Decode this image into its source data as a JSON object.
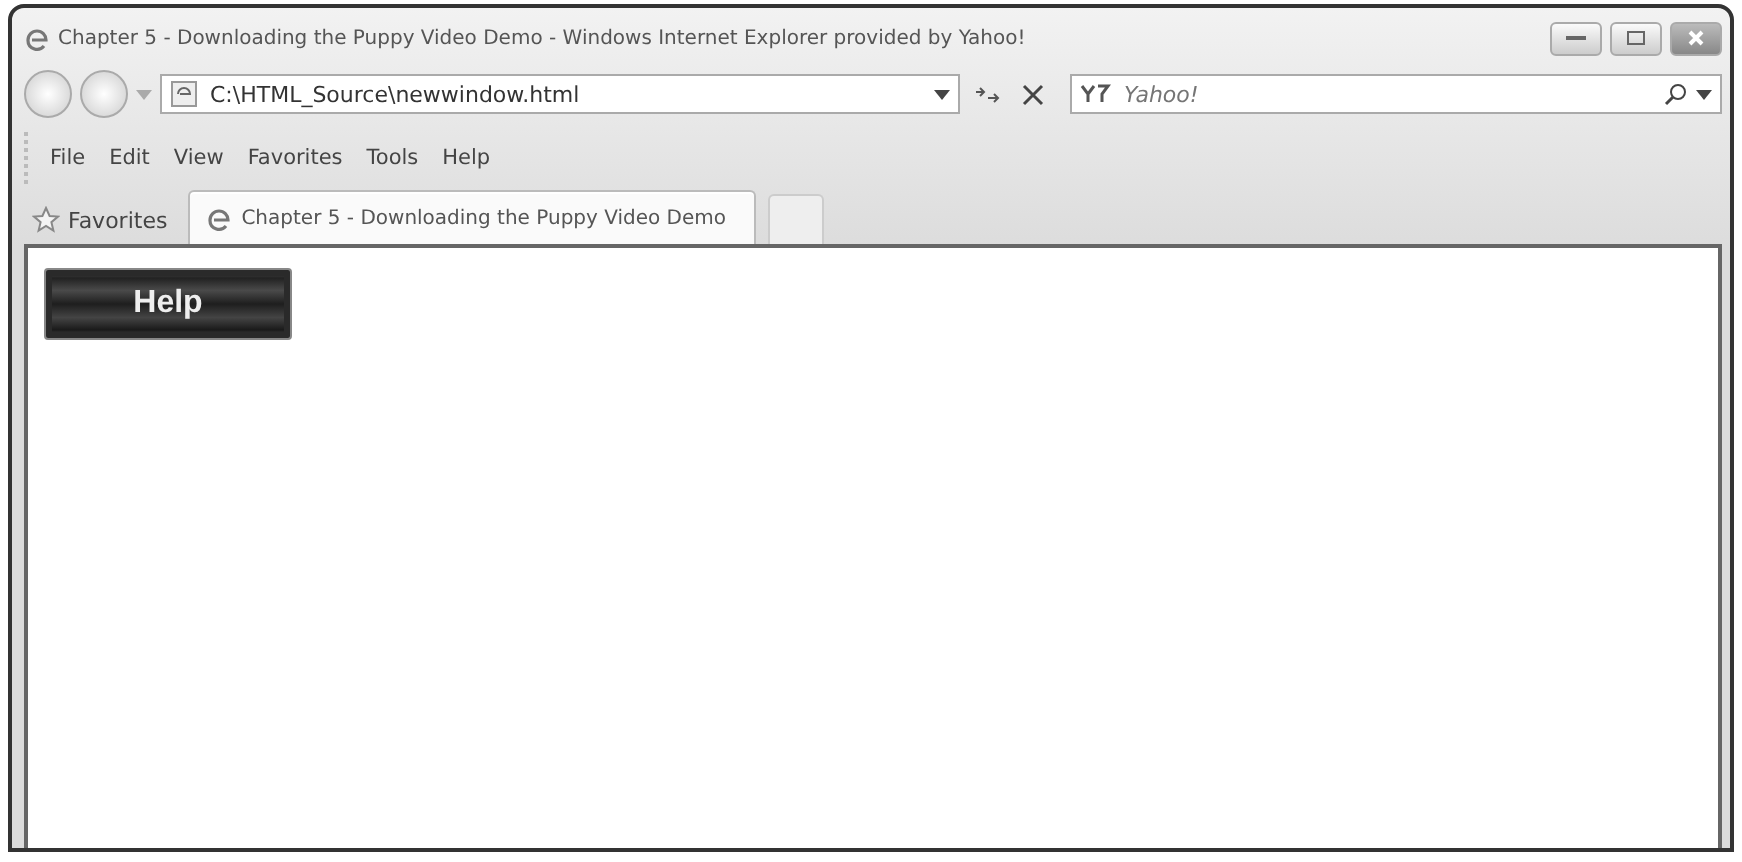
{
  "window": {
    "title": "Chapter 5 - Downloading the Puppy Video Demo - Windows Internet Explorer provided by Yahoo!"
  },
  "address_bar": {
    "value": "C:\\HTML_Source\\newwindow.html"
  },
  "search": {
    "placeholder": "Yahoo!"
  },
  "menu": [
    "File",
    "Edit",
    "View",
    "Favorites",
    "Tools",
    "Help"
  ],
  "favorites": {
    "label": "Favorites"
  },
  "tabs": [
    {
      "label": "Chapter 5 - Downloading the Puppy Video Demo",
      "selected": true
    }
  ],
  "page": {
    "button": "Help"
  }
}
